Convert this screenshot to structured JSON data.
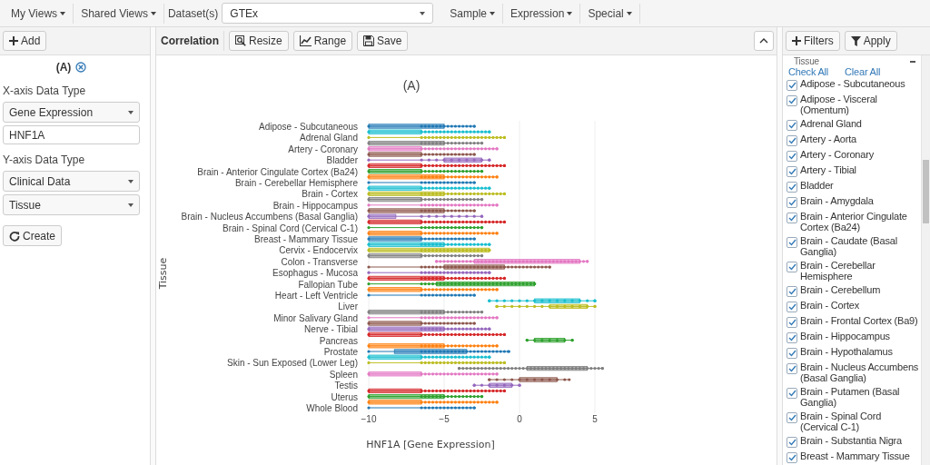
{
  "top_menu": {
    "left": [
      {
        "label": "My Views"
      },
      {
        "label": "Shared Views"
      }
    ],
    "dataset": {
      "label": "Dataset(s)",
      "value": "GTEx"
    },
    "right": [
      {
        "label": "Sample"
      },
      {
        "label": "Expression"
      },
      {
        "label": "Special"
      }
    ]
  },
  "left_panel": {
    "add_button": "Add",
    "plot_label": "(A)",
    "x_axis_label": "X-axis Data Type",
    "x_type": "Gene Expression",
    "gene": "HNF1A",
    "y_axis_label": "Y-axis Data Type",
    "y_type": "Clinical Data",
    "y_field": "Tissue",
    "create_button": "Create"
  },
  "toolbar": {
    "title": "Correlation",
    "buttons": [
      {
        "kind": "resize",
        "label": "Resize"
      },
      {
        "kind": "range",
        "label": "Range"
      },
      {
        "kind": "save",
        "label": "Save"
      }
    ]
  },
  "chart": {
    "title": "(A)",
    "y_axis_title": "Tissue",
    "x_axis_title": "HNF1A [Gene Expression]",
    "x_ticks": [
      "−10",
      "−5",
      "0",
      "5"
    ],
    "row_labels": [
      "Adipose - Subcutaneous",
      "Adrenal Gland",
      "Artery - Coronary",
      "Bladder",
      "Brain - Anterior Cingulate Cortex (Ba24)",
      "Brain - Cerebellar Hemisphere",
      "Brain - Cortex",
      "Brain - Hippocampus",
      "Brain - Nucleus Accumbens (Basal Ganglia)",
      "Brain - Spinal Cord (Cervical C-1)",
      "Breast - Mammary Tissue",
      "Cervix - Endocervix",
      "Colon - Transverse",
      "Esophagus - Mucosa",
      "Fallopian Tube",
      "Heart - Left Ventricle",
      "Liver",
      "Minor Salivary Gland",
      "Nerve - Tibial",
      "Pancreas",
      "Prostate",
      "Skin - Sun Exposed (Lower Leg)",
      "Spleen",
      "Testis",
      "Uterus",
      "Whole Blood"
    ]
  },
  "filters": {
    "add_button": "Filters",
    "apply_button": "Apply",
    "section": "Tissue",
    "check_all": "Check All",
    "clear_all": "Clear All",
    "items": [
      {
        "label": "Adipose - Subcutaneous",
        "checked": true
      },
      {
        "label": "Adipose - Visceral (Omentum)",
        "checked": true
      },
      {
        "label": "Adrenal Gland",
        "checked": true
      },
      {
        "label": "Artery - Aorta",
        "checked": true
      },
      {
        "label": "Artery - Coronary",
        "checked": true
      },
      {
        "label": "Artery - Tibial",
        "checked": true
      },
      {
        "label": "Bladder",
        "checked": true
      },
      {
        "label": "Brain - Amygdala",
        "checked": true
      },
      {
        "label": "Brain - Anterior Cingulate Cortex (Ba24)",
        "checked": true
      },
      {
        "label": "Brain - Caudate (Basal Ganglia)",
        "checked": true
      },
      {
        "label": "Brain - Cerebellar Hemisphere",
        "checked": true
      },
      {
        "label": "Brain - Cerebellum",
        "checked": true
      },
      {
        "label": "Brain - Cortex",
        "checked": true
      },
      {
        "label": "Brain - Frontal Cortex (Ba9)",
        "checked": true
      },
      {
        "label": "Brain - Hippocampus",
        "checked": true
      },
      {
        "label": "Brain - Hypothalamus",
        "checked": true
      },
      {
        "label": "Brain - Nucleus Accumbens (Basal Ganglia)",
        "checked": true
      },
      {
        "label": "Brain - Putamen (Basal Ganglia)",
        "checked": true
      },
      {
        "label": "Brain - Spinal Cord (Cervical C-1)",
        "checked": true
      },
      {
        "label": "Brain - Substantia Nigra",
        "checked": true
      },
      {
        "label": "Breast - Mammary Tissue",
        "checked": true
      }
    ]
  }
}
